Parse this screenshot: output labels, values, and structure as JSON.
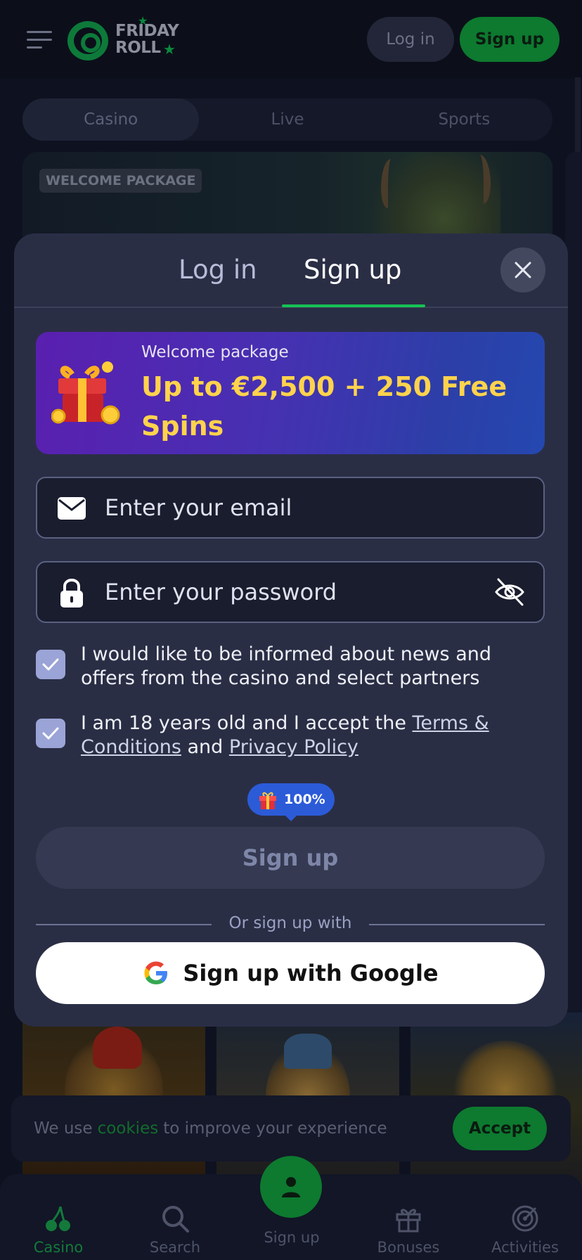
{
  "header": {
    "logo_text_line1": "FRIDAY",
    "logo_text_line2": "ROLL",
    "login_label": "Log in",
    "signup_label": "Sign up"
  },
  "category_tabs": [
    {
      "label": "Casino",
      "active": true
    },
    {
      "label": "Live",
      "active": false
    },
    {
      "label": "Sports",
      "active": false
    }
  ],
  "banner": {
    "tag": "WELCOME PACKAGE"
  },
  "modal": {
    "tabs": {
      "login": "Log in",
      "signup": "Sign up",
      "active": "signup"
    },
    "promo": {
      "label": "Welcome package",
      "title": "Up to €2,500 + 250 Free Spins"
    },
    "email_placeholder": "Enter your email",
    "password_placeholder": "Enter your password",
    "consent_news": "I would like to be informed about news and offers from the casino and select partners",
    "consent_age_prefix": "I am 18 years old and I accept the",
    "terms_link": "Terms & Conditions",
    "consent_and": "and",
    "privacy_link": "Privacy Policy",
    "news_checked": true,
    "age_checked": true,
    "bonus_badge": "100%",
    "submit_label": "Sign up",
    "divider_text": "Or sign up with",
    "google_label": "Sign up with Google"
  },
  "cookie_bar": {
    "text_before": "We use",
    "link": "cookies",
    "text_after": "to improve your experience",
    "accept_label": "Accept"
  },
  "bottom_nav": [
    {
      "label": "Casino",
      "icon": "cherries-icon",
      "active": true
    },
    {
      "label": "Search",
      "icon": "search-icon",
      "active": false
    },
    {
      "label": "Sign up",
      "icon": "user-icon",
      "active": false
    },
    {
      "label": "Bonuses",
      "icon": "gift-icon",
      "active": false
    },
    {
      "label": "Activities",
      "icon": "target-icon",
      "active": false
    }
  ],
  "colors": {
    "brand_green": "#16c254",
    "accent_gold": "#ffd34c",
    "modal_bg": "#2a2e45",
    "page_bg": "#0e1220"
  }
}
